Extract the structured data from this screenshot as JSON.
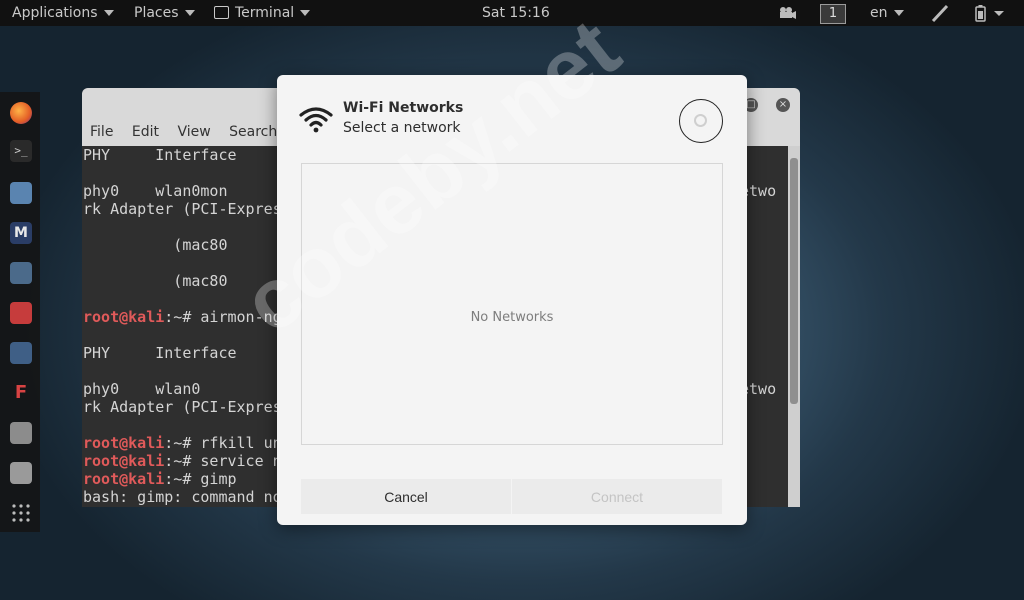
{
  "topbar": {
    "applications": "Applications",
    "places": "Places",
    "terminal": "Terminal",
    "clock": "Sat 15:16",
    "workspace": "1",
    "lang": "en"
  },
  "terminal": {
    "menu": [
      "File",
      "Edit",
      "View",
      "Search"
    ],
    "lines": [
      "PHY     Interface",
      "phy0    wlan0mon",
      "rk Adapter (PCI-Expres",
      "          (mac80",
      "          (mac80",
      "PHY     Interface",
      "phy0    wlan0",
      "rk Adapter (PCI-Expres",
      "bash: gimp: command no"
    ],
    "right_fragments": [
      "etwo",
      "etwo"
    ],
    "prompts": [
      {
        "user": "root@kali",
        "rest": ":~# airmon-ng"
      },
      {
        "user": "root@kali",
        "rest": ":~# rfkill un"
      },
      {
        "user": "root@kali",
        "rest": ":~# service n"
      },
      {
        "user": "root@kali",
        "rest": ":~# gimp"
      }
    ]
  },
  "dialog": {
    "title": "Wi-Fi Networks",
    "subtitle": "Select a network",
    "empty_text": "No Networks",
    "cancel": "Cancel",
    "connect": "Connect"
  },
  "watermark": "codeby.net",
  "colors": {
    "prompt_user": "#e05a5a",
    "dialog_bg": "#f4f4f4",
    "topbar_bg": "#111111"
  }
}
